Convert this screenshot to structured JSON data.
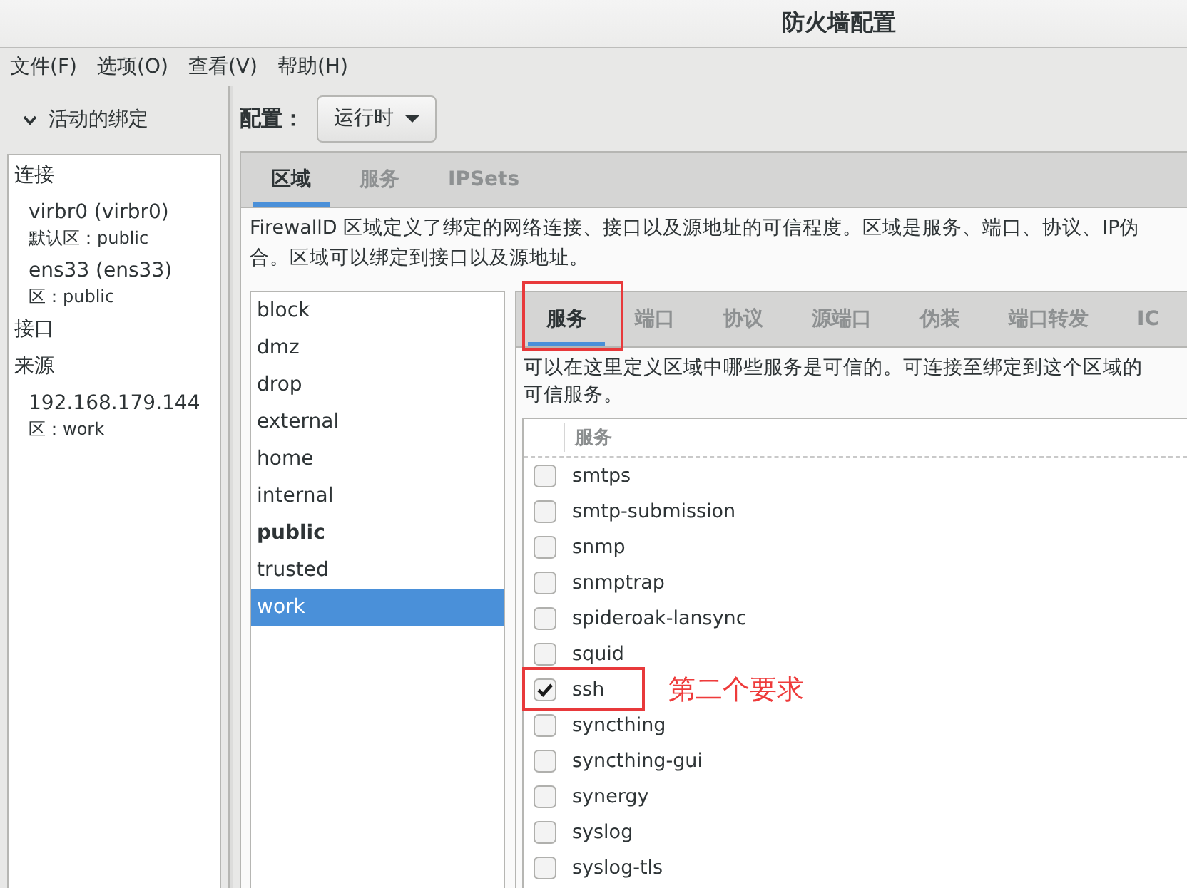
{
  "window": {
    "title": "防火墙配置"
  },
  "menu": [
    "文件(F)",
    "选项(O)",
    "查看(V)",
    "帮助(H)"
  ],
  "bindings": {
    "title": "活动的绑定",
    "expanded": true,
    "groups": [
      {
        "label": "连接",
        "items": [
          {
            "name": "virbr0 (virbr0)",
            "zone": "默认区：public"
          },
          {
            "name": "ens33 (ens33)",
            "zone": "区：public"
          }
        ]
      },
      {
        "label": "接口"
      },
      {
        "label": "来源",
        "items": [
          {
            "name": "192.168.179.144",
            "zone": "区：work"
          }
        ]
      }
    ]
  },
  "config": {
    "label": "配置：",
    "value": "运行时"
  },
  "zone_tabs": [
    {
      "label": "区域",
      "selected": true
    },
    {
      "label": "服务",
      "selected": false
    },
    {
      "label": "IPSets",
      "selected": false
    }
  ],
  "zone_description": [
    "FirewallD 区域定义了绑定的网络连接、接口以及源地址的可信程度。区域是服务、端口、协议、IP伪",
    "合。区域可以绑定到接口以及源地址。"
  ],
  "zones": [
    {
      "name": "block",
      "default": false,
      "selected": false
    },
    {
      "name": "dmz",
      "default": false,
      "selected": false
    },
    {
      "name": "drop",
      "default": false,
      "selected": false
    },
    {
      "name": "external",
      "default": false,
      "selected": false
    },
    {
      "name": "home",
      "default": false,
      "selected": false
    },
    {
      "name": "internal",
      "default": false,
      "selected": false
    },
    {
      "name": "public",
      "default": true,
      "selected": false
    },
    {
      "name": "trusted",
      "default": false,
      "selected": false
    },
    {
      "name": "work",
      "default": false,
      "selected": true
    }
  ],
  "zone_settings_tabs": [
    {
      "label": "服务",
      "selected": true,
      "highlighted": true
    },
    {
      "label": "端口",
      "selected": false,
      "highlighted": false
    },
    {
      "label": "协议",
      "selected": false,
      "highlighted": false
    },
    {
      "label": "源端口",
      "selected": false,
      "highlighted": false
    },
    {
      "label": "伪装",
      "selected": false,
      "highlighted": false
    },
    {
      "label": "端口转发",
      "selected": false,
      "highlighted": false
    },
    {
      "label": "IC",
      "selected": false,
      "highlighted": false
    }
  ],
  "services_description": [
    "可以在这里定义区域中哪些服务是可信的。可连接至绑定到这个区域的",
    "可信服务。"
  ],
  "services_table": {
    "columns": [
      "服务"
    ],
    "rows": [
      {
        "name": "smtps",
        "checked": false,
        "highlighted": false
      },
      {
        "name": "smtp-submission",
        "checked": false,
        "highlighted": false
      },
      {
        "name": "snmp",
        "checked": false,
        "highlighted": false
      },
      {
        "name": "snmptrap",
        "checked": false,
        "highlighted": false
      },
      {
        "name": "spideroak-lansync",
        "checked": false,
        "highlighted": false
      },
      {
        "name": "squid",
        "checked": false,
        "highlighted": false
      },
      {
        "name": "ssh",
        "checked": true,
        "highlighted": true,
        "note": "第二个要求"
      },
      {
        "name": "syncthing",
        "checked": false,
        "highlighted": false
      },
      {
        "name": "syncthing-gui",
        "checked": false,
        "highlighted": false
      },
      {
        "name": "synergy",
        "checked": false,
        "highlighted": false
      },
      {
        "name": "syslog",
        "checked": false,
        "highlighted": false
      },
      {
        "name": "syslog-tls",
        "checked": false,
        "highlighted": false
      }
    ]
  }
}
